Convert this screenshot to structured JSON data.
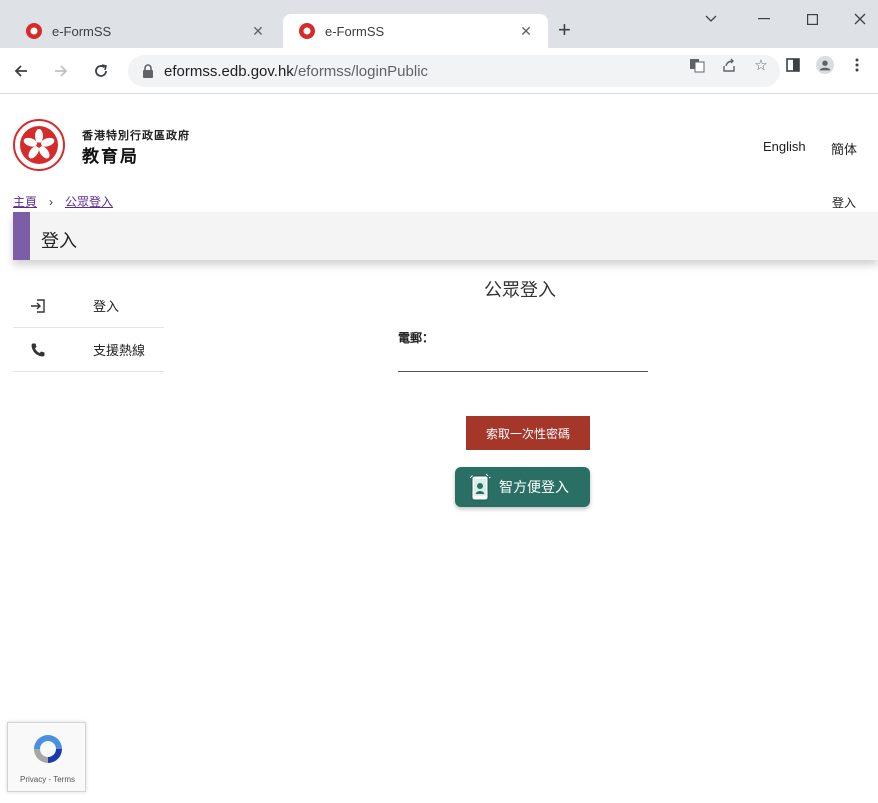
{
  "browser": {
    "tabs": [
      {
        "title": "e-FormSS",
        "active": false
      },
      {
        "title": "e-FormSS",
        "active": true
      }
    ],
    "url_host": "eformss.edb.gov.hk",
    "url_path": "/eformss/loginPublic"
  },
  "header": {
    "org_line1": "香港特別行政區政府",
    "org_line2": "教育局",
    "lang_english": "English",
    "lang_simplified": "簡体"
  },
  "breadcrumb": {
    "home": "主頁",
    "separator": "›",
    "current": "公眾登入"
  },
  "top_login": "登入",
  "page_title": "登入",
  "sidebar": {
    "items": [
      {
        "label": "登入",
        "icon": "login-icon"
      },
      {
        "label": "支援熱線",
        "icon": "phone-icon"
      }
    ]
  },
  "form": {
    "title": "公眾登入",
    "email_label": "電郵：",
    "email_value": "",
    "otp_button": "索取一次性密碼",
    "iam_button": "智方便登入"
  },
  "recaptcha": {
    "links": "Privacy - Terms"
  },
  "colors": {
    "accent_purple": "#7c5ea6",
    "otp_red": "#a5362a",
    "iam_green": "#2a6f63",
    "link_purple": "#5c2d91"
  }
}
